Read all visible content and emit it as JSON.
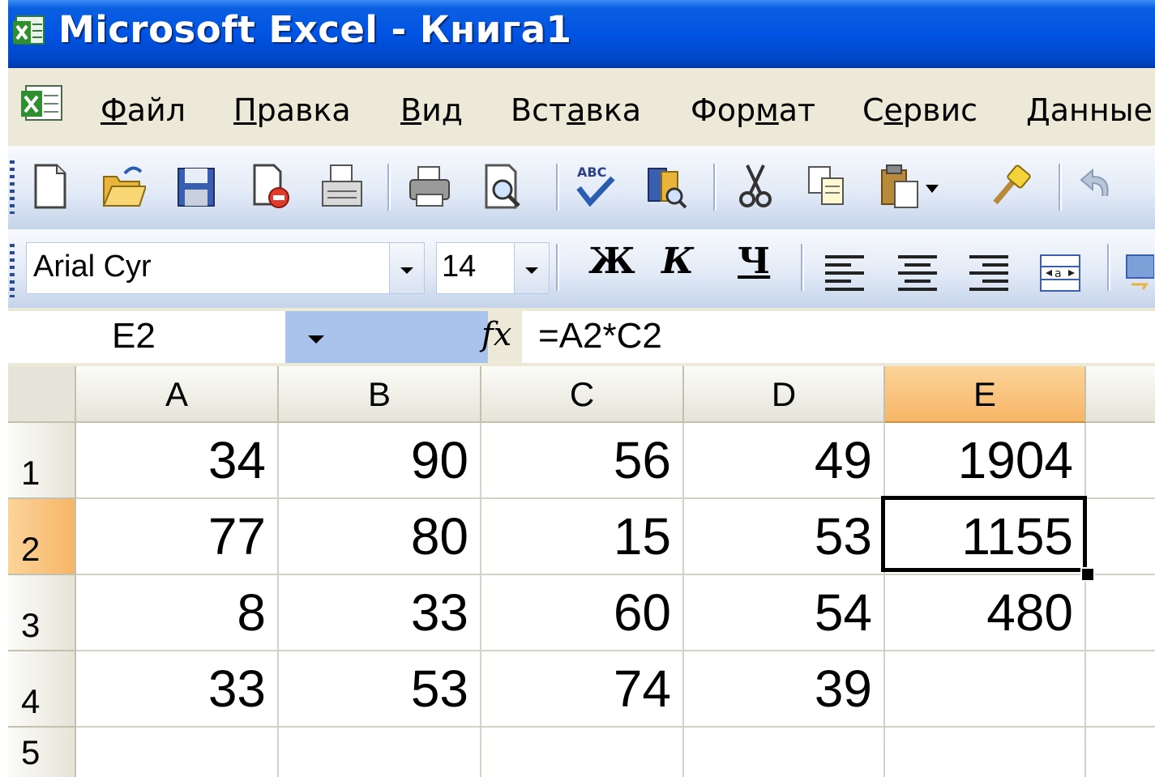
{
  "window": {
    "title": "Microsoft Excel - Книга1"
  },
  "menu": {
    "items": [
      {
        "pre": "",
        "key": "Ф",
        "post": "айл"
      },
      {
        "pre": "",
        "key": "П",
        "post": "равка"
      },
      {
        "pre": "",
        "key": "В",
        "post": "ид"
      },
      {
        "pre": "Вст",
        "key": "а",
        "post": "вка"
      },
      {
        "pre": "Фор",
        "key": "м",
        "post": "ат"
      },
      {
        "pre": "С",
        "key": "е",
        "post": "рвис"
      },
      {
        "pre": "",
        "key": "Д",
        "post": "анные"
      }
    ]
  },
  "formatting": {
    "font_name": "Arial Cyr",
    "font_size": "14",
    "bold_label": "Ж",
    "italic_label": "К",
    "underline_label": "Ч"
  },
  "formula_bar": {
    "name_box": "E2",
    "fx_label": "fx",
    "formula": "=A2*C2"
  },
  "sheet": {
    "columns": [
      "A",
      "B",
      "C",
      "D",
      "E"
    ],
    "active_column": "E",
    "active_row": "2",
    "rows": [
      {
        "num": "1",
        "cells": [
          "34",
          "90",
          "56",
          "49",
          "1904"
        ]
      },
      {
        "num": "2",
        "cells": [
          "77",
          "80",
          "15",
          "53",
          "1155"
        ]
      },
      {
        "num": "3",
        "cells": [
          "8",
          "33",
          "60",
          "54",
          "480"
        ]
      },
      {
        "num": "4",
        "cells": [
          "33",
          "53",
          "74",
          "39",
          ""
        ]
      },
      {
        "num": "5",
        "cells": [
          "",
          "",
          "",
          "",
          ""
        ]
      }
    ]
  },
  "colors": {
    "title_bar": "#0054e3",
    "active_header": "#f7b566",
    "selection_border": "#000000"
  },
  "icons": {
    "app": "excel-app-icon",
    "toolbar": [
      "new-document-icon",
      "open-folder-icon",
      "save-icon",
      "permission-icon",
      "email-icon",
      "print-icon",
      "print-preview-icon",
      "spelling-icon",
      "research-icon",
      "cut-icon",
      "copy-icon",
      "paste-icon",
      "format-painter-icon",
      "undo-icon"
    ]
  }
}
